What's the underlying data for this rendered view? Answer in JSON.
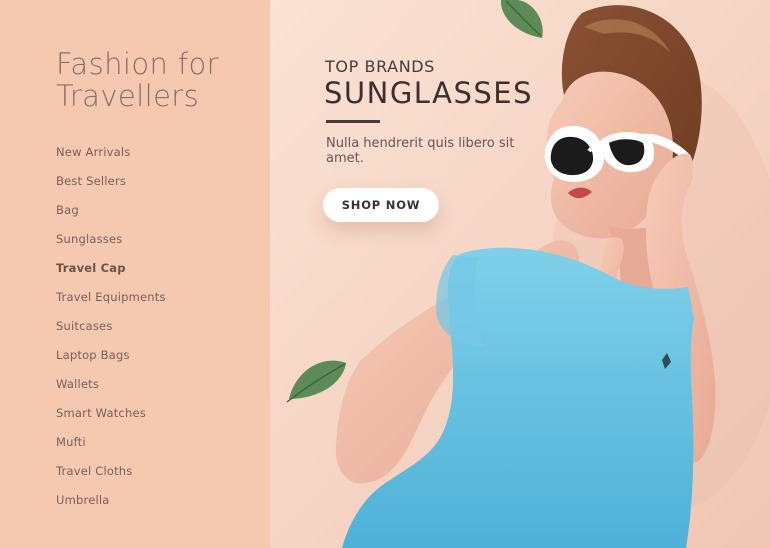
{
  "sidebar": {
    "title_line1": "Fashion for",
    "title_line2": "Travellers",
    "items": [
      {
        "label": "New Arrivals",
        "active": false
      },
      {
        "label": "Best Sellers",
        "active": false
      },
      {
        "label": "Bag",
        "active": false
      },
      {
        "label": "Sunglasses",
        "active": false
      },
      {
        "label": "Travel Cap",
        "active": true
      },
      {
        "label": "Travel Equipments",
        "active": false
      },
      {
        "label": "Suitcases",
        "active": false
      },
      {
        "label": "Laptop Bags",
        "active": false
      },
      {
        "label": "Wallets",
        "active": false
      },
      {
        "label": "Smart Watches",
        "active": false
      },
      {
        "label": "Mufti",
        "active": false
      },
      {
        "label": "Travel Cloths",
        "active": false
      },
      {
        "label": "Umbrella",
        "active": false
      }
    ]
  },
  "hero": {
    "kicker": "TOP BRANDS",
    "headline": "SUNGLASSES",
    "description": "Nulla hendrerit quis libero sit amet.",
    "cta_label": "SHOP NOW"
  },
  "colors": {
    "sidebar_bg": "#f4c9b0",
    "hero_bg": "#f8d8c8",
    "text_brown": "#7a5f57",
    "dress": "#62bddf",
    "leaf": "#5c8b57"
  }
}
